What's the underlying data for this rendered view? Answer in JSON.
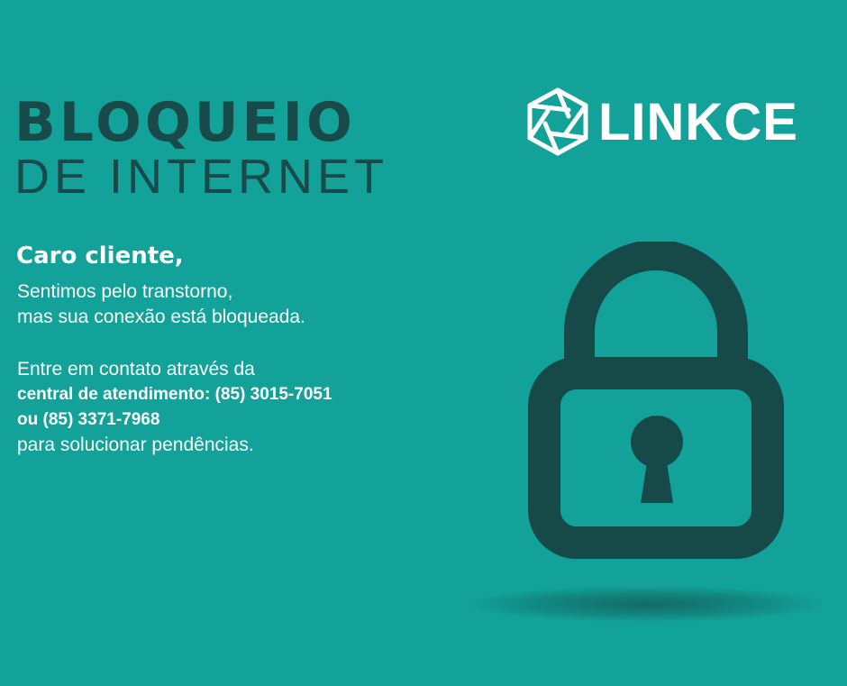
{
  "header": {
    "title_line1": "BLOQUEIO",
    "title_line2": "DE INTERNET"
  },
  "message": {
    "greeting": "Caro cliente,",
    "line1": "Sentimos pelo transtorno,",
    "line2": "mas sua conexão está bloqueada.",
    "contact_intro": "Entre em contato através da",
    "contact_phone1": "central de atendimento: (85) 3015-7051",
    "contact_phone2": "ou (85) 3371-7968",
    "contact_outro": "para solucionar pendências."
  },
  "brand": {
    "name": "LINKCE",
    "logo_icon": "hexagon-aperture-icon",
    "color_text": "#ffffff"
  },
  "illustration": {
    "icon": "padlock-icon",
    "color": "#164a49"
  },
  "colors": {
    "background": "#12a29a",
    "title": "#174a48",
    "text": "#ffffff"
  }
}
